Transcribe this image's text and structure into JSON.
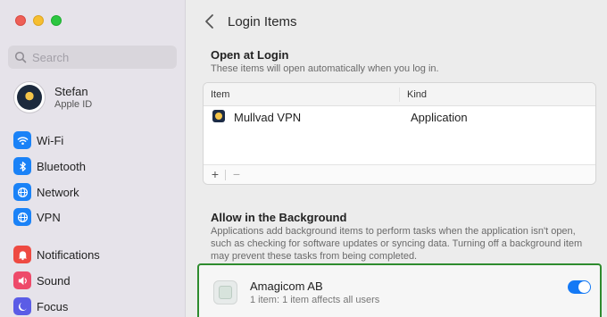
{
  "sidebar": {
    "search": {
      "placeholder": "Search"
    },
    "profile": {
      "name": "Stefan",
      "subtitle": "Apple ID"
    },
    "items": [
      {
        "label": "Wi-Fi",
        "icon": "wifi-icon",
        "color": "#1a82f7"
      },
      {
        "label": "Bluetooth",
        "icon": "bluetooth-icon",
        "color": "#1a82f7"
      },
      {
        "label": "Network",
        "icon": "globe-icon",
        "color": "#1a82f7"
      },
      {
        "label": "VPN",
        "icon": "globe-icon",
        "color": "#1a82f7"
      },
      {
        "label": "Notifications",
        "icon": "bell-icon",
        "color": "#ee4a42"
      },
      {
        "label": "Sound",
        "icon": "speaker-icon",
        "color": "#ee4a6a"
      },
      {
        "label": "Focus",
        "icon": "moon-icon",
        "color": "#5b5ce6"
      }
    ]
  },
  "main": {
    "title": "Login Items",
    "open_at_login": {
      "title": "Open at Login",
      "description": "These items will open automatically when you log in.",
      "columns": [
        "Item",
        "Kind"
      ],
      "rows": [
        {
          "item": "Mullvad VPN",
          "kind": "Application",
          "icon": "mullvad-app-icon"
        }
      ],
      "add_label": "+",
      "remove_label": "−"
    },
    "background": {
      "title": "Allow in the Background",
      "description": "Applications add background items to perform tasks when the application isn't open, such as checking for software updates or syncing data. Turning off a background item may prevent these tasks from being completed.",
      "items": [
        {
          "name": "Amagicom AB",
          "detail": "1 item: 1 item affects all users",
          "enabled": true
        }
      ]
    }
  },
  "colors": {
    "accent": "#1479f5",
    "highlight": "#2e8b2e"
  }
}
